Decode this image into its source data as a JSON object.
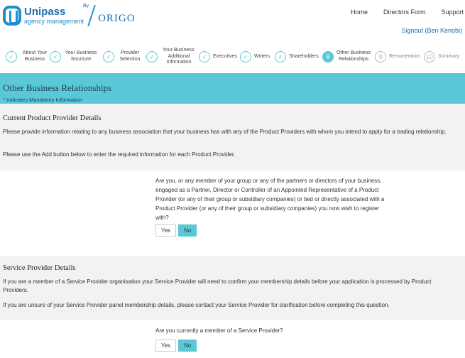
{
  "brand": {
    "name": "Unipass",
    "tagline": "agency management",
    "by": "By",
    "partner": "ORIGO"
  },
  "topnav": {
    "home": "Home",
    "directors_form": "Directors Form",
    "support": "Support",
    "signout": "Signout (Ben Kenobi)"
  },
  "stepper": {
    "steps": [
      {
        "label": "About Your Business",
        "status": "done",
        "marker": ""
      },
      {
        "label": "Your Business Structure",
        "status": "done",
        "marker": ""
      },
      {
        "label": "Provider Selection",
        "status": "done",
        "marker": ""
      },
      {
        "label": "Your Business: Additional Information",
        "status": "done",
        "marker": ""
      },
      {
        "label": "Executives",
        "status": "done",
        "marker": ""
      },
      {
        "label": "Writers",
        "status": "done",
        "marker": ""
      },
      {
        "label": "Shareholders",
        "status": "done",
        "marker": ""
      },
      {
        "label": "Other Business Relationships",
        "status": "current",
        "marker": "8"
      },
      {
        "label": "Remuneration",
        "status": "future",
        "marker": "9"
      },
      {
        "label": "Summary",
        "status": "future",
        "marker": "10"
      }
    ]
  },
  "section": {
    "title": "Other Business Relationships",
    "mandatory_note": "* Indicates Mandatory Information"
  },
  "current_provider": {
    "title": "Current Product Provider Details",
    "text1": "Please provide information relating to any business association that your business has with any of the Product Providers with whom you intend to apply for a trading relationship.",
    "text2": "Please use the Add button below to enter the required information for each Product Provider.",
    "question": "Are you, or any member of your group or any of the partners or directors of your business, engaged as a Partner, Director or Controller of an Appointed Representative of a Product Provider (or any of their group or subsidiary companies) or tied or directly associated with a Product Provider (or any of their group or subsidiary companies) you now wish to register with?",
    "yes_label": "Yes",
    "no_label": "No",
    "selected": "No"
  },
  "service_provider": {
    "title": "Service Provider Details",
    "text1": "If you are a member of a Service Provider organisation your Service Provider will need to confirm your membership details before your application is processed by Product Providers.",
    "text2": "If you are unsure of your Service Provider panel membership details, please contact your Service Provider for clarification before completing this question.",
    "question": "Are you currently a member of a Service Provider?",
    "yes_label": "Yes",
    "no_label": "No",
    "selected": "No"
  },
  "colors": {
    "accent": "#5bc8d8",
    "brand_blue": "#1d6fae",
    "panel_grey": "#f2f2f2"
  }
}
